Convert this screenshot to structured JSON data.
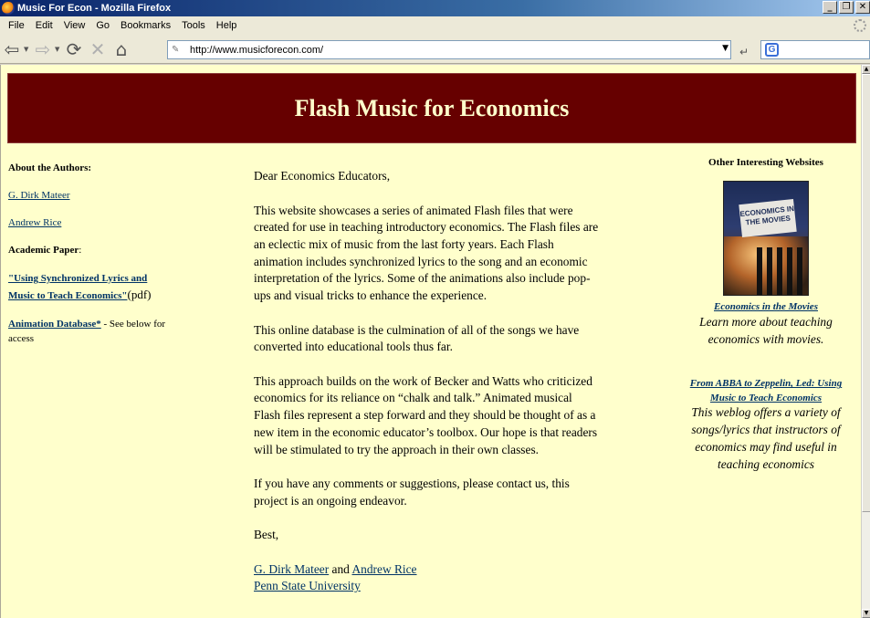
{
  "window": {
    "title": "Music For Econ - Mozilla Firefox"
  },
  "menu": {
    "items": [
      "File",
      "Edit",
      "View",
      "Go",
      "Bookmarks",
      "Tools",
      "Help"
    ]
  },
  "toolbar": {
    "url": "http://www.musicforecon.com/"
  },
  "page": {
    "banner_title": "Flash Music for Economics",
    "left": {
      "about_heading": "About the Authors:",
      "author1": "G. Dirk Mateer",
      "author2": "Andrew Rice",
      "paper_heading": "Academic Paper",
      "paper_colon": ":",
      "paper_link": "\"Using Synchronized Lyrics and Music to Teach Economics\"",
      "paper_suffix": "(pdf)",
      "db_link": "Animation Database*",
      "db_note": " - See below for access"
    },
    "center": {
      "greeting": "Dear Economics Educators,",
      "p1": "This website showcases a series of animated Flash files that were created for use in teaching introductory economics. The Flash files are an eclectic mix of music from the last forty years. Each Flash animation includes synchronized lyrics to the song and an economic interpretation of the lyrics.  Some of the animations also include pop-ups and visual tricks to enhance the experience.",
      "p2": "This online database is the culmination of all of the songs we have converted into educational tools thus far.",
      "p3": "This approach builds on the work of Becker and Watts who criticized economics for its reliance on “chalk and talk.” Animated musical Flash files represent a step forward and they should be thought of as a new item in the economic educator’s toolbox. Our hope is that readers will be stimulated to try the approach in their own classes.",
      "p4": "If you have any comments or suggestions, please contact us, this project is an ongoing endeavor.",
      "closing": "Best,",
      "sig_author1": "G. Dirk Mateer",
      "sig_and": " and ",
      "sig_author2": "Andrew Rice",
      "sig_university": "Penn State University"
    },
    "right": {
      "heading": "Other Interesting Websites",
      "poster_text": "ECONOMICS IN THE MOVIES",
      "link1": "Economics in the Movies ",
      "desc1": "Learn more about teaching economics with movies.",
      "link2": "From ABBA to Zeppelin, Led: Using Music to Teach Economics",
      "desc2": "This weblog offers a variety of songs/lyrics that instructors of economics may find useful in teaching economics"
    }
  }
}
